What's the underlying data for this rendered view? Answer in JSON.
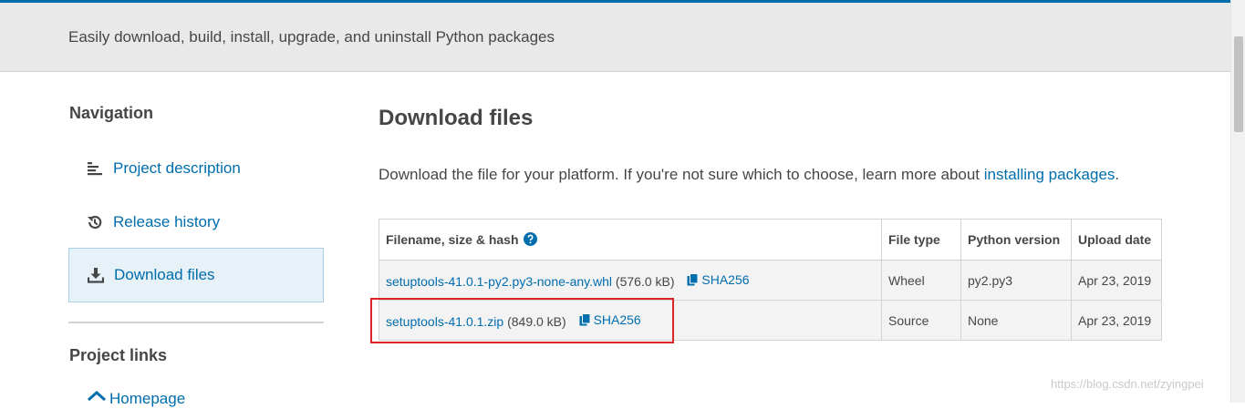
{
  "banner": {
    "tagline": "Easily download, build, install, upgrade, and uninstall Python packages"
  },
  "sidebar": {
    "heading": "Navigation",
    "items": [
      {
        "label": "Project description",
        "icon": "align-left-icon"
      },
      {
        "label": "Release history",
        "icon": "history-icon"
      },
      {
        "label": "Download files",
        "icon": "download-icon",
        "active": true
      }
    ],
    "links_heading": "Project links",
    "homepage_label": "Homepage"
  },
  "main": {
    "title": "Download files",
    "intro_text": "Download the file for your platform. If you're not sure which to choose, learn more about ",
    "intro_link": "installing packages",
    "intro_end": ".",
    "table": {
      "headers": [
        "Filename, size & hash",
        "File type",
        "Python version",
        "Upload date"
      ],
      "rows": [
        {
          "filename": "setuptools-41.0.1-py2.py3-none-any.whl",
          "size": "(576.0 kB)",
          "hash": "SHA256",
          "file_type": "Wheel",
          "python_version": "py2.py3",
          "upload_date": "Apr 23, 2019"
        },
        {
          "filename": "setuptools-41.0.1.zip",
          "size": "(849.0 kB)",
          "hash": "SHA256",
          "file_type": "Source",
          "python_version": "None",
          "upload_date": "Apr 23, 2019"
        }
      ]
    }
  },
  "watermark": "https://blog.csdn.net/zyingpei",
  "colors": {
    "link": "#006dad",
    "highlight": "#d9252b",
    "active_bg": "#e6f1f8"
  }
}
